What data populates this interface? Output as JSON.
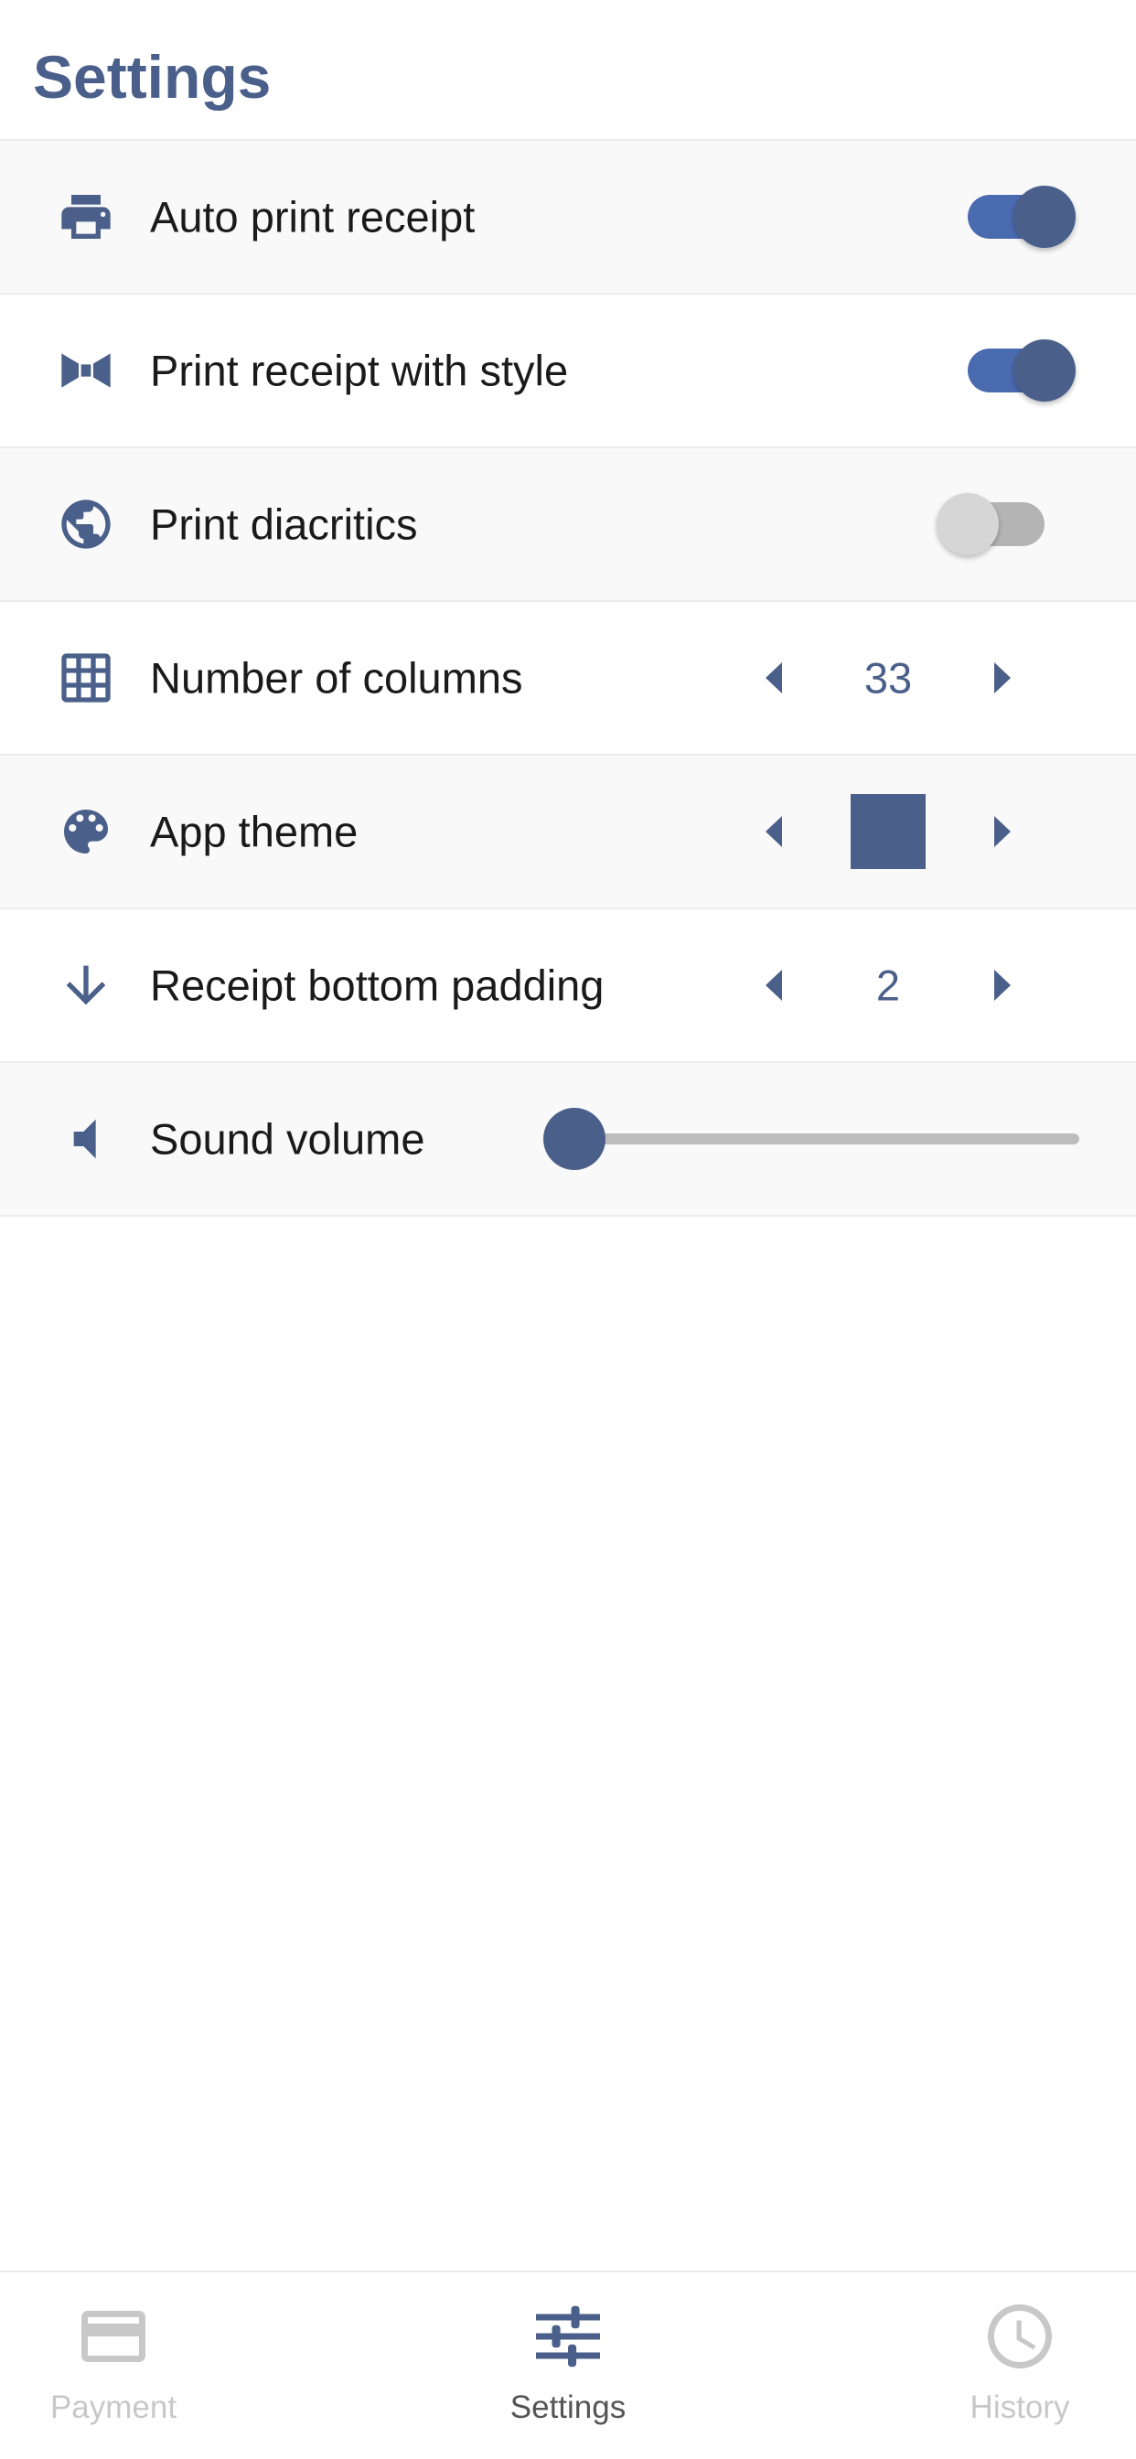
{
  "header": {
    "title": "Settings"
  },
  "colors": {
    "accent": "#4a5f8a",
    "toggle_track_on": "#4a6bb0",
    "toggle_track_off": "#b4b4b4",
    "nav_inactive": "#c8c8c8"
  },
  "settings": {
    "auto_print": {
      "label": "Auto print receipt",
      "icon": "printer-icon",
      "enabled": true
    },
    "print_style": {
      "label": "Print receipt with style",
      "icon": "bow-tie-icon",
      "enabled": true
    },
    "diacritics": {
      "label": "Print diacritics",
      "icon": "globe-icon",
      "enabled": false
    },
    "columns": {
      "label": "Number of columns",
      "icon": "grid-icon",
      "value": "33"
    },
    "theme": {
      "label": "App theme",
      "icon": "palette-icon",
      "swatch_color": "#4a5f8a"
    },
    "bottom_padding": {
      "label": "Receipt bottom padding",
      "icon": "arrow-down-icon",
      "value": "2"
    },
    "volume": {
      "label": "Sound volume",
      "icon": "speaker-icon",
      "level": 0.0
    }
  },
  "bottom_nav": {
    "items": [
      {
        "label": "Payment",
        "icon": "credit-card-icon",
        "active": false
      },
      {
        "label": "Settings",
        "icon": "sliders-icon",
        "active": true
      },
      {
        "label": "History",
        "icon": "clock-icon",
        "active": false
      }
    ]
  }
}
